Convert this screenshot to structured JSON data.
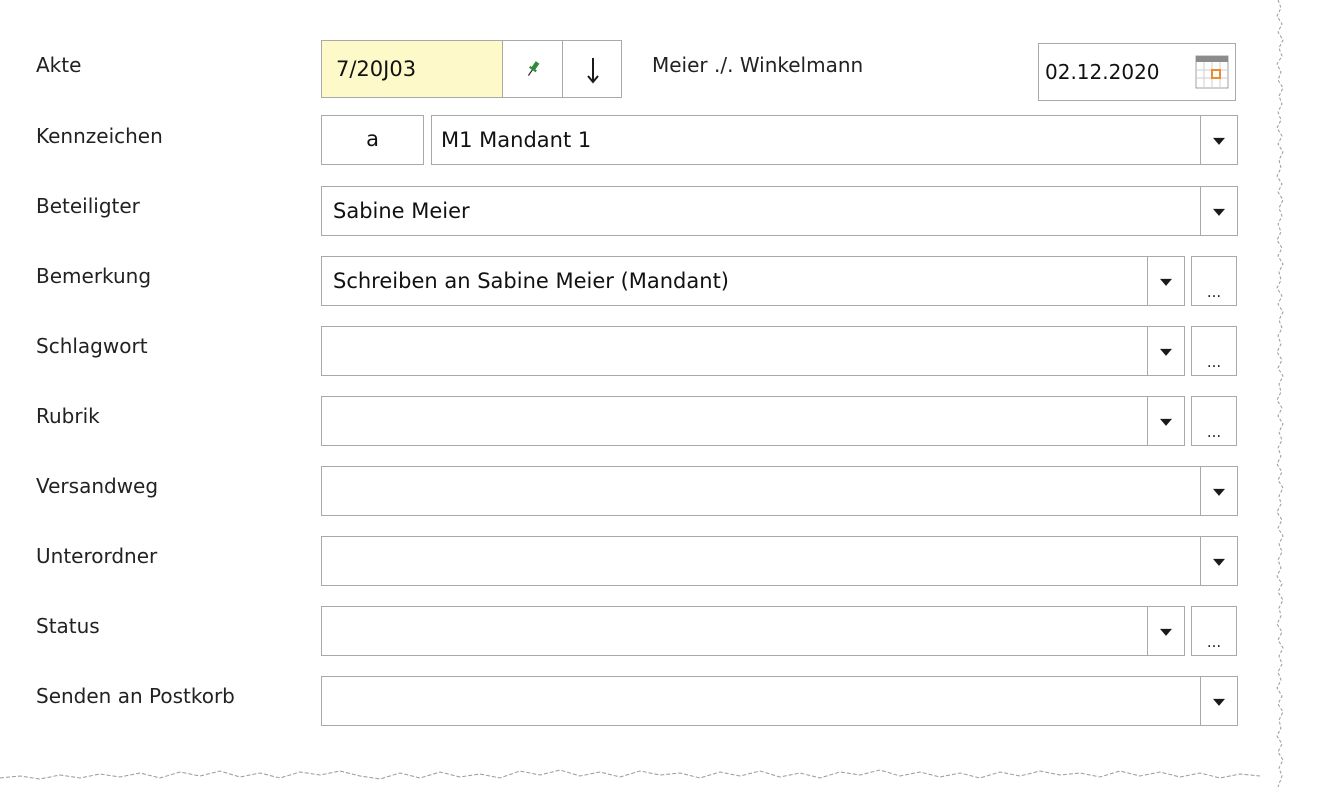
{
  "rows": [
    {
      "label": "Akte"
    },
    {
      "label": "Kennzeichen"
    },
    {
      "label": "Beteiligter"
    },
    {
      "label": "Bemerkung"
    },
    {
      "label": "Schlagwort"
    },
    {
      "label": "Rubrik"
    },
    {
      "label": "Versandweg"
    },
    {
      "label": "Unterordner"
    },
    {
      "label": "Status"
    },
    {
      "label": "Senden an Postkorb"
    }
  ],
  "akte": {
    "number": "7/20J03",
    "parties": "Meier ./. Winkelmann",
    "date": "02.12.2020",
    "pin_icon": "pin-icon",
    "arrow_icon": "arrow-down-icon",
    "calendar_icon": "calendar-icon"
  },
  "kennzeichen": {
    "code": "a",
    "value": "M1 Mandant 1"
  },
  "beteiligter": {
    "value": "Sabine Meier"
  },
  "bemerkung": {
    "value": "Schreiben an Sabine Meier (Mandant)",
    "more": "..."
  },
  "schlagwort": {
    "value": "",
    "more": "..."
  },
  "rubrik": {
    "value": "",
    "more": "..."
  },
  "versandweg": {
    "value": ""
  },
  "unterordner": {
    "value": ""
  },
  "status": {
    "value": "",
    "more": "..."
  },
  "postkorb": {
    "value": ""
  },
  "colors": {
    "akte_bg": "#fdf9c8",
    "border": "#a9a9a9",
    "pin": "#2e8b3a",
    "calendar_accent": "#f08a2c"
  }
}
